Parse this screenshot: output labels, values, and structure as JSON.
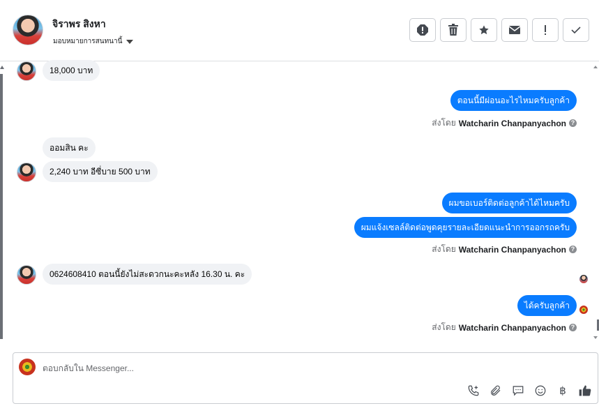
{
  "header": {
    "contact_name": "จิราพร สิงหา",
    "assign_label": "มอบหมายการสนทนานี้"
  },
  "actions": [
    {
      "name": "spam-button",
      "icon": "alert-octagon-icon",
      "glyph": "!"
    },
    {
      "name": "delete-button",
      "icon": "trash-icon",
      "glyph": ""
    },
    {
      "name": "star-button",
      "icon": "star-icon",
      "glyph": "★"
    },
    {
      "name": "mark-unread-button",
      "icon": "envelope-icon",
      "glyph": "✉"
    },
    {
      "name": "follow-up-button",
      "icon": "exclamation-icon",
      "glyph": "!"
    },
    {
      "name": "mark-done-button",
      "icon": "check-icon",
      "glyph": "✓"
    }
  ],
  "messages": [
    {
      "dir": "in",
      "text": "18,000 บาท"
    },
    {
      "dir": "out",
      "text": "ตอนนี้มีผ่อนอะไรไหมครับลูกค้า"
    },
    {
      "dir": "meta",
      "prefix": "ส่งโดย",
      "name": "Watcharin Chanpanyachon"
    },
    {
      "dir": "in",
      "text": "ออมสิน คะ"
    },
    {
      "dir": "in",
      "text": "2,240 บาท อีซี่บาย 500 บาท"
    },
    {
      "dir": "out",
      "text": "ผมขอเบอร์ติดต่อลูกค้าได้ไหมครับ"
    },
    {
      "dir": "out",
      "text": "ผมแจ้งเซลล์ติดต่อพูดคุยรายละเอียดแนะนำการออกรถครับ"
    },
    {
      "dir": "meta",
      "prefix": "ส่งโดย",
      "name": "Watcharin Chanpanyachon"
    },
    {
      "dir": "in",
      "text": "0624608410 ตอนนี้ยังไม่สะดวกนะคะหลัง 16.30 น. คะ"
    },
    {
      "dir": "out",
      "text": "ได้ครับลูกค้า"
    },
    {
      "dir": "meta",
      "prefix": "ส่งโดย",
      "name": "Watcharin Chanpanyachon"
    }
  ],
  "composer": {
    "placeholder": "ตอบกลับใน Messenger...",
    "tools": [
      "phone-plus-icon",
      "paperclip-icon",
      "chat-bubbles-icon",
      "emoji-icon",
      "baht-icon",
      "thumbs-up-icon"
    ],
    "baht_glyph": "฿"
  },
  "colors": {
    "outgoing_bubble": "#0a7cff",
    "incoming_bubble": "#f0f2f5"
  }
}
